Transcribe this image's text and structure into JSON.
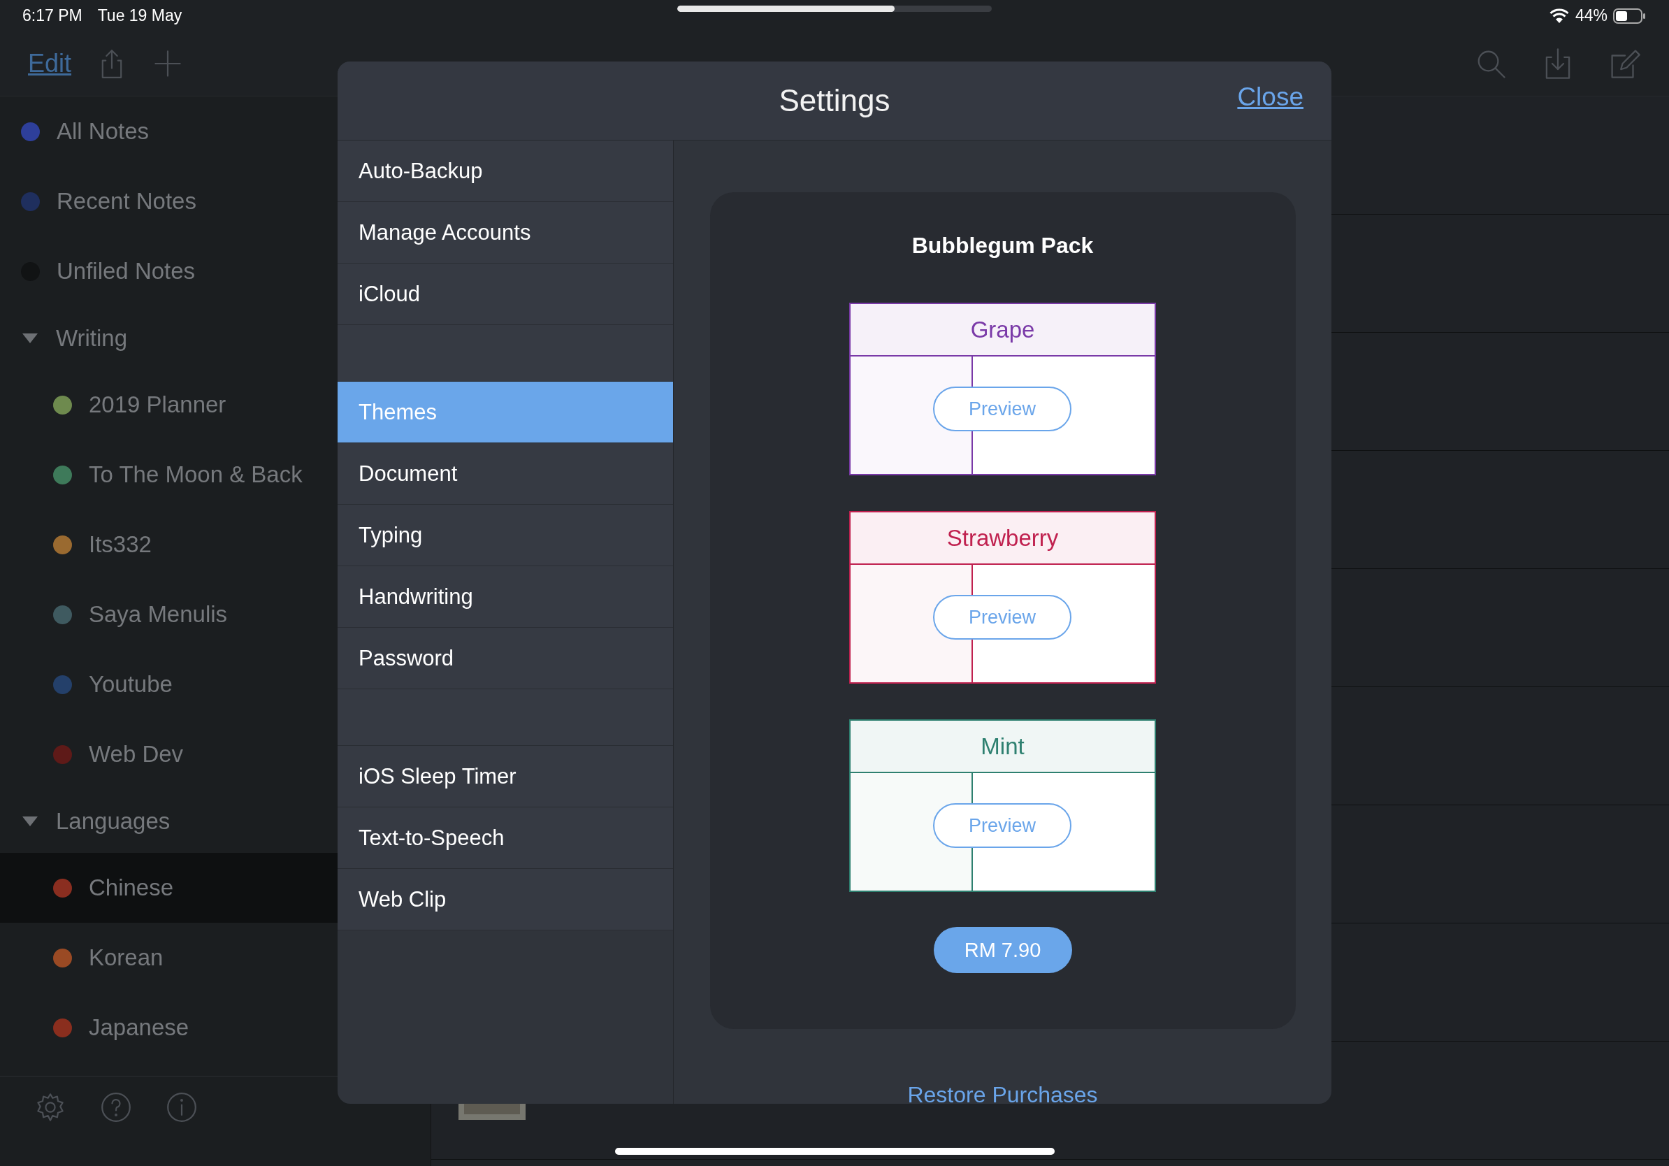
{
  "status_bar": {
    "time": "6:17 PM",
    "date": "Tue 19 May",
    "battery": "44%"
  },
  "sync_progress": {
    "level": 0.69
  },
  "nav_bar": {
    "edit": "Edit"
  },
  "sidebar": {
    "items": [
      {
        "kind": "item",
        "label": "All Notes",
        "color": "#2e3f9a",
        "selected": false
      },
      {
        "kind": "item",
        "label": "Recent Notes",
        "color": "#1f2f5e",
        "selected": false
      },
      {
        "kind": "item",
        "label": "Unfiled Notes",
        "color": "#111314",
        "selected": false
      },
      {
        "kind": "group",
        "label": "Writing",
        "expanded": true,
        "children": [
          {
            "kind": "item",
            "label": "2019 Planner",
            "color": "#6e8a4e",
            "selected": false
          },
          {
            "kind": "item",
            "label": "To The Moon & Back",
            "color": "#3e7a5a",
            "selected": false
          },
          {
            "kind": "item",
            "label": "Its332",
            "color": "#9a6a30",
            "selected": false
          },
          {
            "kind": "item",
            "label": "Saya Menulis",
            "color": "#3f5a60",
            "selected": false
          },
          {
            "kind": "item",
            "label": "Youtube",
            "color": "#24406a",
            "selected": false
          },
          {
            "kind": "item",
            "label": "Web Dev",
            "color": "#5e1a18",
            "selected": false
          }
        ]
      },
      {
        "kind": "group",
        "label": "Languages",
        "expanded": true,
        "children": [
          {
            "kind": "item",
            "label": "Chinese",
            "color": "#8a2e20",
            "selected": true
          },
          {
            "kind": "item",
            "label": "Korean",
            "color": "#9a4a24",
            "selected": false
          },
          {
            "kind": "item",
            "label": "Japanese",
            "color": "#8a2e1e",
            "selected": false
          }
        ]
      }
    ]
  },
  "settings": {
    "title": "Settings",
    "close": "Close",
    "menu_sections": [
      {
        "items": [
          {
            "label": "Auto-Backup",
            "selected": false
          },
          {
            "label": "Manage Accounts",
            "selected": false
          },
          {
            "label": "iCloud",
            "selected": false
          }
        ]
      },
      {
        "items": [
          {
            "label": "Themes",
            "selected": true
          },
          {
            "label": "Document",
            "selected": false
          },
          {
            "label": "Typing",
            "selected": false
          },
          {
            "label": "Handwriting",
            "selected": false
          },
          {
            "label": "Password",
            "selected": false
          }
        ]
      },
      {
        "items": [
          {
            "label": "iOS Sleep Timer",
            "selected": false
          },
          {
            "label": "Text-to-Speech",
            "selected": false
          },
          {
            "label": "Web Clip",
            "selected": false
          }
        ]
      }
    ],
    "store": {
      "title": "Bubblegum Pack",
      "themes": [
        {
          "name": "Grape",
          "color": "#7a3aa8",
          "button": "Preview"
        },
        {
          "name": "Strawberry",
          "color": "#c0214f",
          "button": "Preview"
        },
        {
          "name": "Mint",
          "color": "#2e8070",
          "button": "Preview"
        }
      ],
      "price": "RM 7.90",
      "restore": "Restore Purchases"
    }
  }
}
